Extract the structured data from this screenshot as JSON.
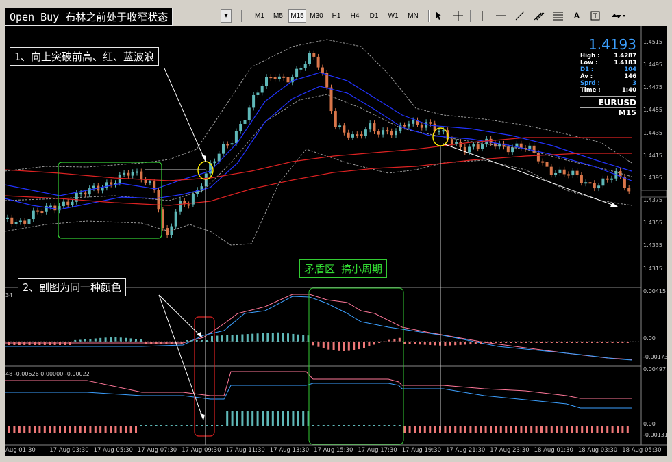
{
  "window": {
    "title_note": "Open_Buy 布林之前处于收窄状态"
  },
  "toolbar": {
    "timeframes": [
      "M1",
      "M5",
      "M15",
      "M30",
      "H1",
      "H4",
      "D1",
      "W1",
      "MN"
    ],
    "active_timeframe": "M15"
  },
  "annotations": {
    "note1": "1、向上突破前高、红、蓝波浪",
    "note2": "2、副图为同一种颜色",
    "note3": "矛盾区  搞小周期"
  },
  "info_panel": {
    "price": "1.4193",
    "high_label": "High :",
    "high": "1.4287",
    "low_label": "Low :",
    "low": "1.4183",
    "d1_label": "D1 :",
    "d1": "104",
    "av_label": "Av :",
    "av": "146",
    "sprd_label": "Sprd :",
    "sprd": "3",
    "time_label": "Time :",
    "time": "1:40",
    "symbol": "EURUSD",
    "timeframe": "M15"
  },
  "price_axis": [
    "1.4515",
    "1.4495",
    "1.4475",
    "1.4455",
    "1.4435",
    "1.4415",
    "1.4395",
    "1.4375",
    "1.4355",
    "1.4335",
    "1.4315"
  ],
  "sub1": {
    "left_label": "34",
    "axis": [
      "0.00415",
      "0.00",
      "-0.00173"
    ]
  },
  "sub2": {
    "left_label": "48 -0.00626 0.00000 -0.00022",
    "axis": [
      "0.00497",
      "0.00",
      "-0.00131"
    ]
  },
  "time_axis": [
    "Aug 01:30",
    "17 Aug 03:30",
    "17 Aug 05:30",
    "17 Aug 07:30",
    "17 Aug 09:30",
    "17 Aug 11:30",
    "17 Aug 13:30",
    "17 Aug 15:30",
    "17 Aug 17:30",
    "17 Aug 19:30",
    "17 Aug 21:30",
    "17 Aug 23:30",
    "18 Aug 01:30",
    "18 Aug 03:30",
    "18 Aug 05:30"
  ],
  "colors": {
    "bull": "#5fb8b8",
    "bear": "#d9764a",
    "blue": "#2233ff",
    "red": "#dd2222",
    "green": "#33cc33",
    "yellow": "#ffee00",
    "price": "#3ca0ff"
  }
}
